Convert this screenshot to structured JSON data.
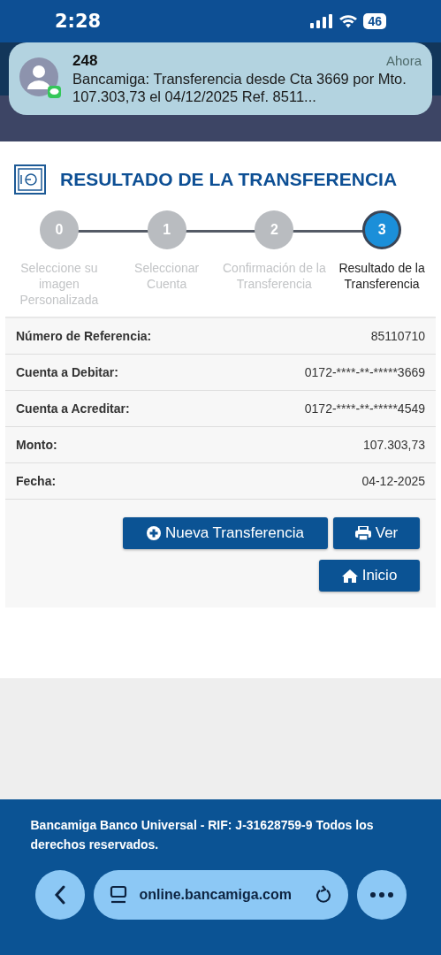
{
  "status_bar": {
    "time": "2:28",
    "battery": "46"
  },
  "notification": {
    "sender": "248",
    "time": "Ahora",
    "message": "Bancamiga: Transferencia desde Cta 3669 por Mto. 107.303,73 el 04/12/2025 Ref. 8511..."
  },
  "page": {
    "title": "RESULTADO DE LA TRANSFERENCIA"
  },
  "steps": [
    {
      "number": "0",
      "label": "Seleccione su imagen Personalizada",
      "selected": false
    },
    {
      "number": "1",
      "label": "Seleccionar Cuenta",
      "selected": false
    },
    {
      "number": "2",
      "label": "Confirmación de la Transferencia",
      "selected": false
    },
    {
      "number": "3",
      "label": "Resultado de la Transferencia",
      "selected": true
    }
  ],
  "details": [
    {
      "label": "Número de Referencia:",
      "value": "85110710"
    },
    {
      "label": "Cuenta a Debitar:",
      "value": "0172-****-**-*****3669"
    },
    {
      "label": "Cuenta a Acreditar:",
      "value": "0172-****-**-*****4549"
    },
    {
      "label": "Monto:",
      "value": "107.303,73"
    },
    {
      "label": "Fecha:",
      "value": "04-12-2025"
    }
  ],
  "buttons": [
    {
      "label": "Nueva Transferencia",
      "kind": "plus"
    },
    {
      "label": "Ver",
      "kind": "print"
    },
    {
      "label": "Inicio",
      "kind": "home"
    }
  ],
  "footer": {
    "text": "Bancamiga Banco Universal - RIF: J-31628759-9 Todos los derechos reservados."
  },
  "browser": {
    "url": "online.bancamiga.com"
  }
}
